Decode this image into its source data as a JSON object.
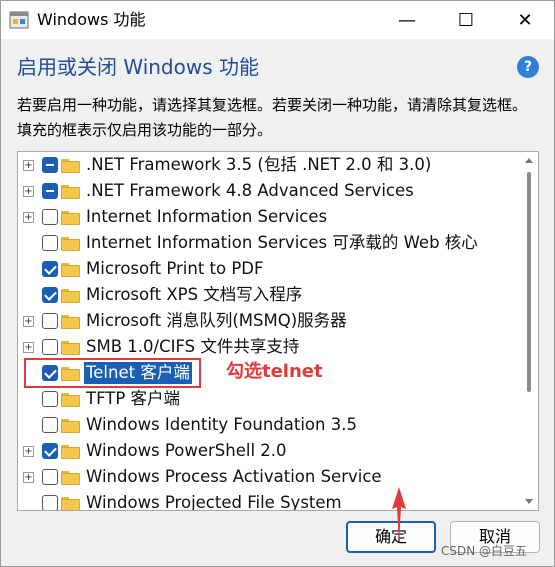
{
  "window": {
    "title": "Windows 功能",
    "minimize_label": "—",
    "maximize_label": "☐",
    "close_label": "✕"
  },
  "header": {
    "heading": "启用或关闭 Windows 功能",
    "help_label": "?",
    "description": "若要启用一种功能，请选择其复选框。若要关闭一种功能，请清除其复选框。填充的框表示仅启用该功能的一部分。"
  },
  "features": [
    {
      "label": ".NET Framework 3.5 (包括 .NET 2.0 和 3.0)",
      "expandable": true,
      "state": "partial",
      "selected": false
    },
    {
      "label": ".NET Framework 4.8 Advanced Services",
      "expandable": true,
      "state": "partial",
      "selected": false
    },
    {
      "label": "Internet Information Services",
      "expandable": true,
      "state": "unchecked",
      "selected": false
    },
    {
      "label": "Internet Information Services 可承载的 Web 核心",
      "expandable": false,
      "state": "unchecked",
      "selected": false
    },
    {
      "label": "Microsoft Print to PDF",
      "expandable": false,
      "state": "checked",
      "selected": false
    },
    {
      "label": "Microsoft XPS 文档写入程序",
      "expandable": false,
      "state": "checked",
      "selected": false
    },
    {
      "label": "Microsoft 消息队列(MSMQ)服务器",
      "expandable": true,
      "state": "unchecked",
      "selected": false
    },
    {
      "label": "SMB 1.0/CIFS 文件共享支持",
      "expandable": true,
      "state": "unchecked",
      "selected": false
    },
    {
      "label": "Telnet 客户端",
      "expandable": false,
      "state": "checked",
      "selected": true
    },
    {
      "label": "TFTP 客户端",
      "expandable": false,
      "state": "unchecked",
      "selected": false
    },
    {
      "label": "Windows Identity Foundation 3.5",
      "expandable": false,
      "state": "unchecked",
      "selected": false
    },
    {
      "label": "Windows PowerShell 2.0",
      "expandable": true,
      "state": "checked",
      "selected": false
    },
    {
      "label": "Windows Process Activation Service",
      "expandable": true,
      "state": "unchecked",
      "selected": false
    },
    {
      "label": "Windows Projected File System",
      "expandable": false,
      "state": "unchecked",
      "selected": false
    }
  ],
  "annotation": {
    "text": "勾选telnet",
    "color": "#e33b3b"
  },
  "buttons": {
    "ok_label": "确定",
    "cancel_label": "取消"
  },
  "watermark": "CSDN @白豆五",
  "colors": {
    "accent": "#1a5fb4",
    "heading": "#1f4e96",
    "folder": "#f4c84c"
  }
}
